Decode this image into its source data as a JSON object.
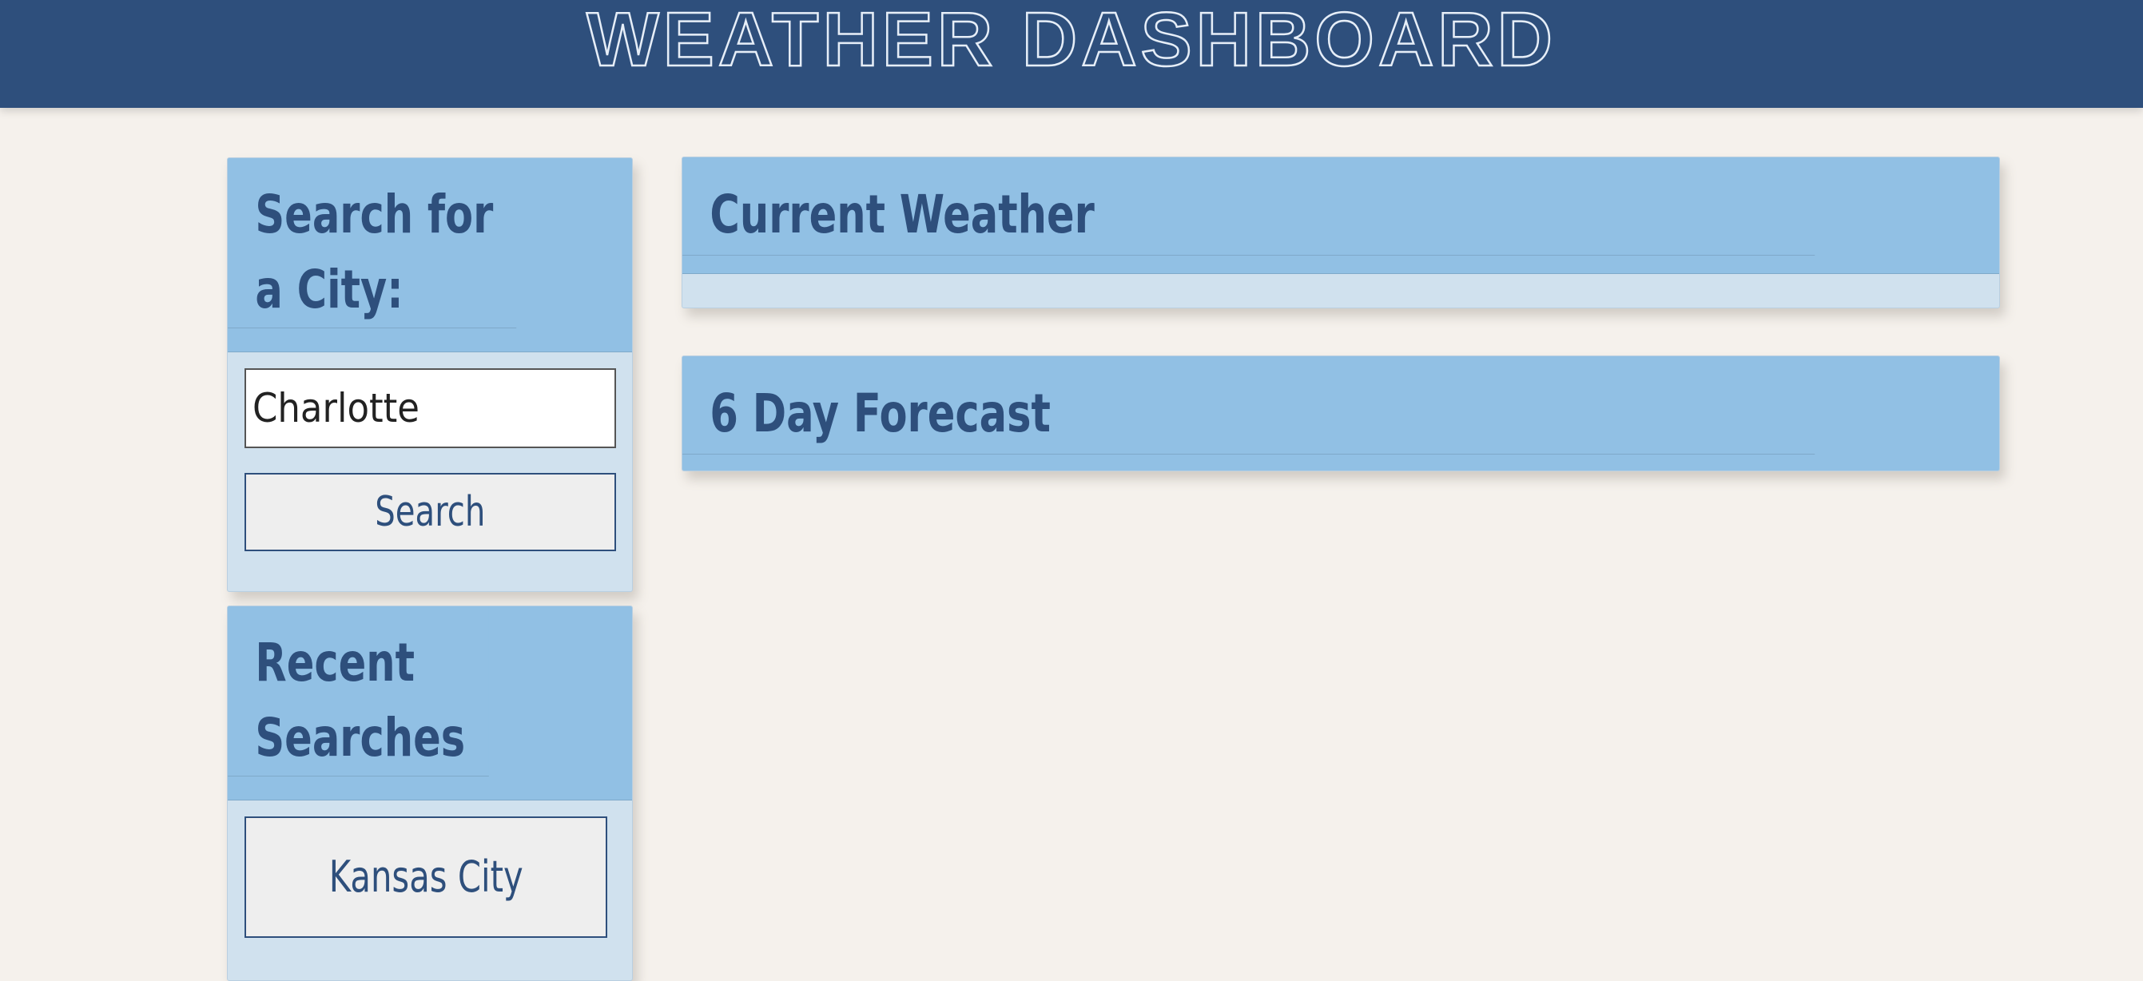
{
  "header": {
    "title": "WEATHER DASHBOARD"
  },
  "search": {
    "heading": "Search for a City:",
    "input_value": "Charlotte",
    "input_placeholder": "",
    "button_label": "Search"
  },
  "recent": {
    "heading": "Recent Searches",
    "items": [
      {
        "label": "Kansas City"
      }
    ]
  },
  "current": {
    "heading": "Current Weather"
  },
  "forecast": {
    "heading": "6 Day Forecast"
  },
  "colors": {
    "header_bg": "#2e4f7c",
    "card_head_bg": "#91c0e4",
    "card_body_bg": "#d0e1ee",
    "page_bg": "#f5f1ec",
    "text_primary": "#2e4f7c"
  }
}
